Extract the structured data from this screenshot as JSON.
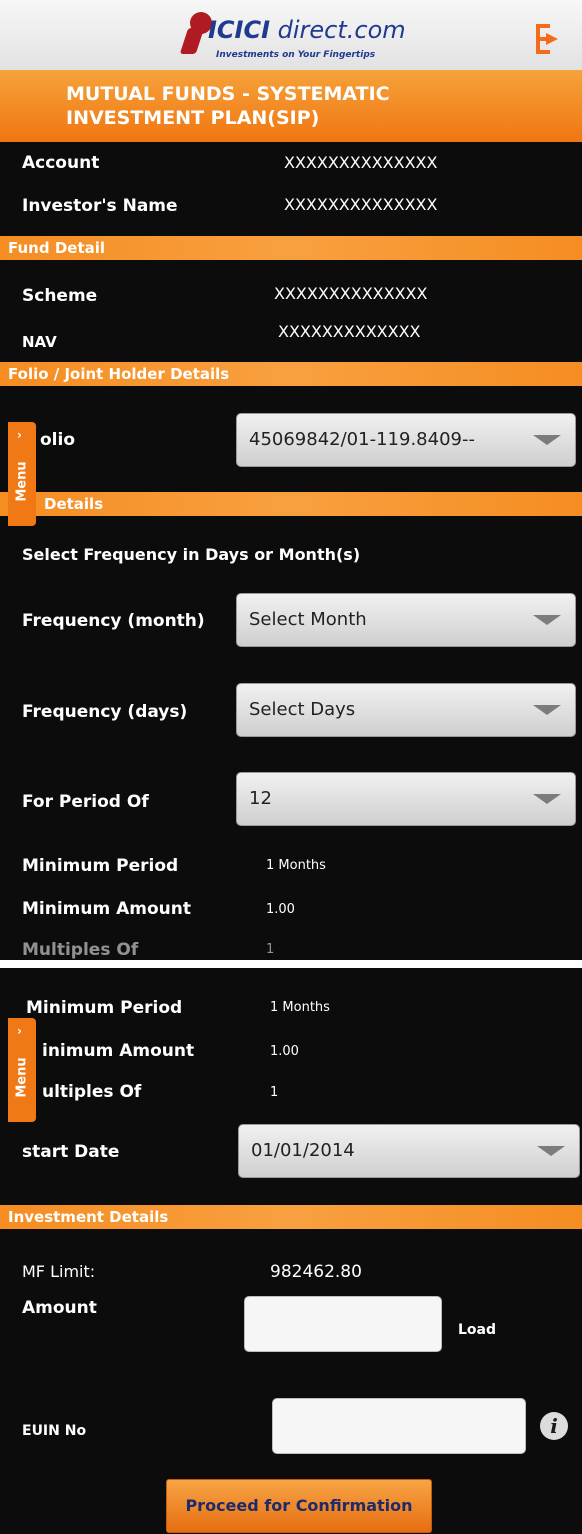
{
  "header": {
    "logo_brand_bold": "ICICI",
    "logo_brand_light": " direct.com",
    "logo_tagline": "Investments on Your Fingertips",
    "title_line1": "MUTUAL FUNDS - SYSTEMATIC",
    "title_line2": "INVESTMENT PLAN(SIP)",
    "logout_icon": "logout-icon"
  },
  "account": {
    "account_label": "Account",
    "account_value": "XXXXXXXXXXXXXX",
    "investor_label": "Investor's Name",
    "investor_value": "XXXXXXXXXXXXXX"
  },
  "fund_detail": {
    "section": "Fund Detail",
    "scheme_label": "Scheme",
    "scheme_value": "XXXXXXXXXXXXXX",
    "nav_label": "NAV",
    "nav_value": "XXXXXXXXXXXXX"
  },
  "folio": {
    "section": "Folio / Joint Holder Details",
    "folio_label_visible": "olio",
    "folio_value": "45069842/01-119.8409--"
  },
  "sip": {
    "section_visible": "Details",
    "frequency_hint": "Select Frequency in Days or Month(s)",
    "freq_month_label": "Frequency (month)",
    "freq_month_value": "Select Month",
    "freq_days_label": "Frequency (days)",
    "freq_days_value": "Select Days",
    "period_label": "For Period Of",
    "period_value": "12",
    "min_period_label": "Minimum Period",
    "min_period_value": "1 Months",
    "min_amount_label": "Minimum Amount",
    "min_amount_value": "1.00",
    "multiples_label": "Multiples Of",
    "multiples_value": "1"
  },
  "screen2": {
    "min_period_label": "Minimum Period",
    "min_period_value": "1 Months",
    "min_amount_label_visible": "inimum Amount",
    "min_amount_value": "1.00",
    "multiples_label_visible": "ultiples Of",
    "multiples_value": "1",
    "start_date_label": "start Date",
    "start_date_value": "01/01/2014"
  },
  "investment": {
    "section": "Investment Details",
    "mf_limit_label": "MF Limit:",
    "mf_limit_value": "982462.80",
    "amount_label": "Amount",
    "amount_value": "",
    "load_label": "Load",
    "euin_label": "EUIN No",
    "euin_value": "",
    "info_glyph": "i",
    "proceed_button": "Proceed for Confirmation"
  },
  "menu": {
    "label": "Menu",
    "chevron": "›"
  },
  "colors": {
    "accent_orange": "#f07815",
    "background": "#0c0c0c",
    "brand_blue": "#1f3a8f",
    "brand_red": "#b01b23"
  }
}
